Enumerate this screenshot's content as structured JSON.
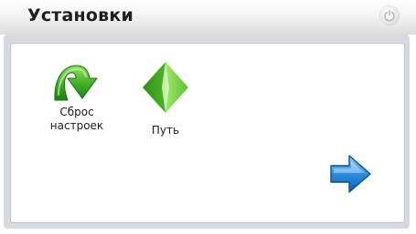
{
  "header": {
    "title": "Установки",
    "power_icon": "power-icon"
  },
  "items": [
    {
      "label_line1": "Сброс",
      "label_line2": "настроек",
      "icon": "reset-arrow-icon",
      "color": "#3fae24"
    },
    {
      "label": "Путь",
      "icon": "route-pyramid-icon",
      "color": "#4bb528"
    }
  ],
  "navigation": {
    "next_icon": "arrow-right-icon",
    "accent": "#2a8ee0"
  }
}
